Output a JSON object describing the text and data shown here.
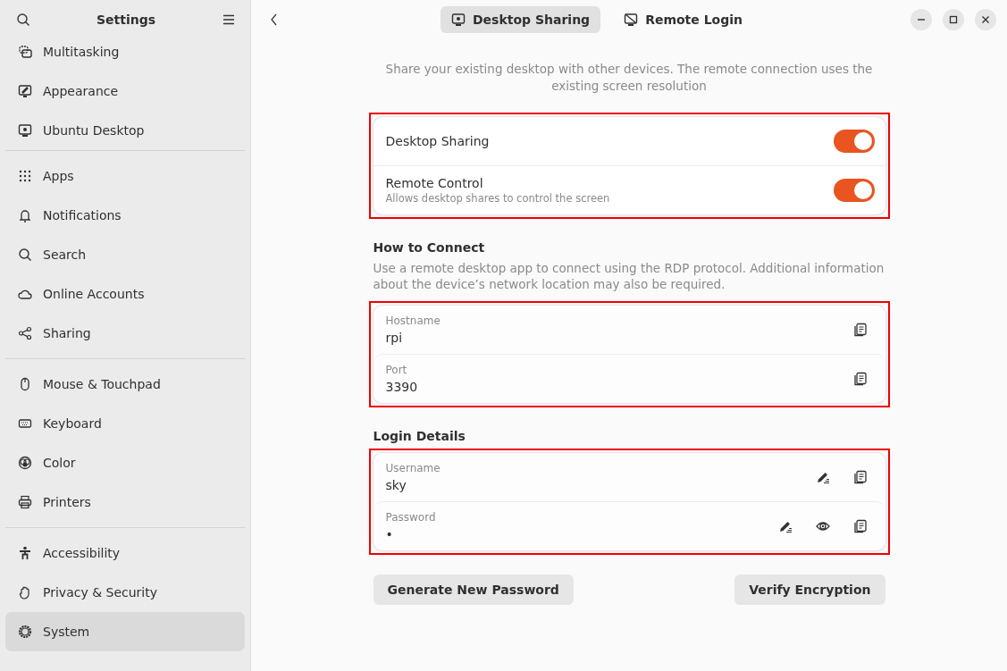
{
  "sidebar": {
    "title": "Settings",
    "groups": [
      [
        {
          "label": "Multitasking",
          "kind": "multitasking",
          "selected": false
        },
        {
          "label": "Appearance",
          "kind": "appearance",
          "selected": false
        },
        {
          "label": "Ubuntu Desktop",
          "kind": "desktop",
          "selected": false
        }
      ],
      [
        {
          "label": "Apps",
          "kind": "apps",
          "selected": false
        },
        {
          "label": "Notifications",
          "kind": "bell",
          "selected": false
        },
        {
          "label": "Search",
          "kind": "search",
          "selected": false
        },
        {
          "label": "Online Accounts",
          "kind": "cloud",
          "selected": false
        },
        {
          "label": "Sharing",
          "kind": "share",
          "selected": false
        }
      ],
      [
        {
          "label": "Mouse & Touchpad",
          "kind": "mouse",
          "selected": false
        },
        {
          "label": "Keyboard",
          "kind": "keyboard",
          "selected": false
        },
        {
          "label": "Color",
          "kind": "color",
          "selected": false
        },
        {
          "label": "Printers",
          "kind": "printer",
          "selected": false
        }
      ],
      [
        {
          "label": "Accessibility",
          "kind": "accessibility",
          "selected": false
        },
        {
          "label": "Privacy & Security",
          "kind": "hand",
          "selected": false
        },
        {
          "label": "System",
          "kind": "gear",
          "selected": true
        }
      ]
    ]
  },
  "tabs": [
    {
      "label": "Desktop Sharing",
      "kind": "desktop",
      "selected": true
    },
    {
      "label": "Remote Login",
      "kind": "remote",
      "selected": false
    }
  ],
  "intro": "Share your existing desktop with other devices. The remote connection uses the existing screen resolution",
  "switches": [
    {
      "label": "Desktop Sharing",
      "on": true
    },
    {
      "label": "Remote Control",
      "subtitle": "Allows desktop shares to control the screen",
      "on": true
    }
  ],
  "connect": {
    "heading": "How to Connect",
    "description": "Use a remote desktop app to connect using the RDP protocol. Additional information about the device’s network location may also be required.",
    "fields": [
      {
        "label": "Hostname",
        "value": "rpi",
        "editable": false,
        "revealable": false,
        "copyable": true
      },
      {
        "label": "Port",
        "value": "3390",
        "editable": false,
        "revealable": false,
        "copyable": true
      }
    ]
  },
  "login": {
    "heading": "Login Details",
    "fields": [
      {
        "label": "Username",
        "value": "sky",
        "editable": true,
        "revealable": false,
        "copyable": true
      },
      {
        "label": "Password",
        "value": "•",
        "editable": true,
        "revealable": true,
        "copyable": true
      }
    ]
  },
  "buttons": [
    "Generate New Password",
    "Verify Encryption"
  ]
}
